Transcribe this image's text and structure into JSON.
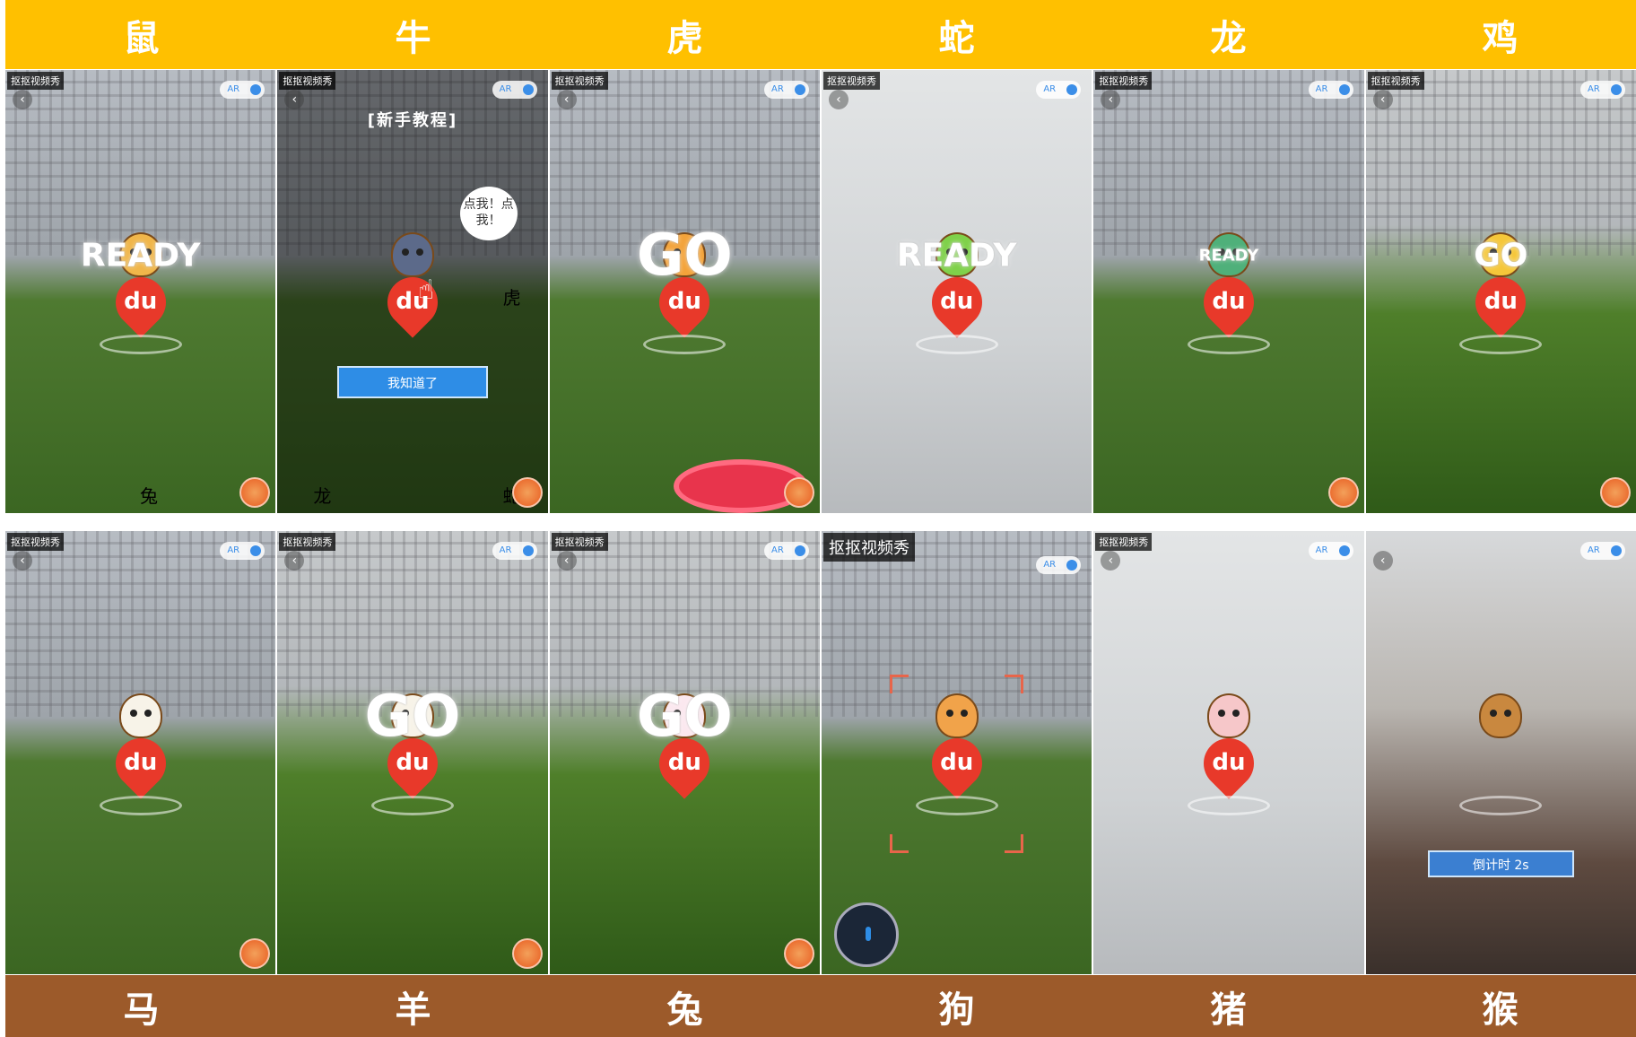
{
  "top_band": {
    "labels": [
      "鼠",
      "牛",
      "虎",
      "蛇",
      "龙",
      "鸡"
    ],
    "color": "#ffc000"
  },
  "bottom_band": {
    "labels": [
      "马",
      "羊",
      "兔",
      "狗",
      "猪",
      "猴"
    ],
    "color": "#9c5a2a"
  },
  "app_tag": "抠抠视频秀",
  "ar_toggle_label": "AR",
  "row1": [
    {
      "status": "READY",
      "marker_text": "du",
      "overlay_label": "兔"
    },
    {
      "tutorial_title": "[新手教程]",
      "bubble_text": "点我！点我！",
      "ok_button": "我知道了",
      "marker_text": "du",
      "overlay_labels": [
        "虎",
        "龙",
        "蛇"
      ]
    },
    {
      "status": "GO",
      "marker_text": "du"
    },
    {
      "status": "READY",
      "marker_text": "du"
    },
    {
      "status": "READY",
      "marker_text": "du"
    },
    {
      "status": "GO",
      "marker_text": "du"
    }
  ],
  "row2": [
    {
      "marker_text": "du"
    },
    {
      "status": "GO",
      "marker_text": "du"
    },
    {
      "status": "GO",
      "marker_text": "du"
    },
    {
      "marker_text": "du"
    },
    {
      "marker_text": "du"
    },
    {
      "timer_label": "倒计时 2s"
    }
  ]
}
